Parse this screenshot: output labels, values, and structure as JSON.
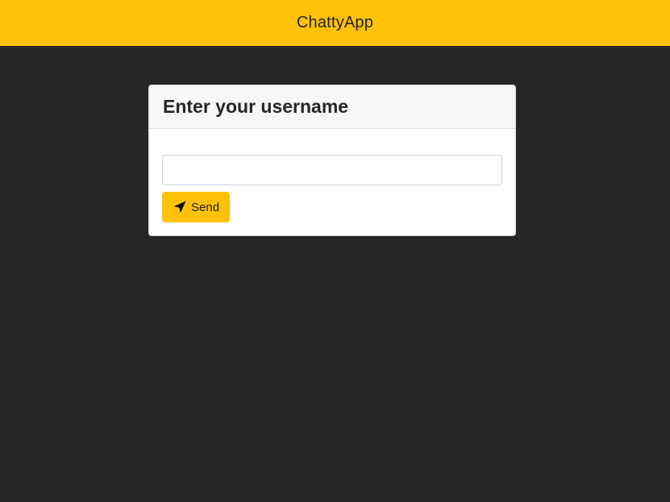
{
  "header": {
    "app_title": "ChattyApp"
  },
  "login_card": {
    "title": "Enter your username",
    "input": {
      "value": "",
      "placeholder": ""
    },
    "send_button": {
      "label": "Send",
      "icon": "paper-plane-icon"
    }
  },
  "colors": {
    "accent": "#ffc107",
    "background": "#262626",
    "card": "#ffffff",
    "card_header": "#f7f7f7"
  }
}
